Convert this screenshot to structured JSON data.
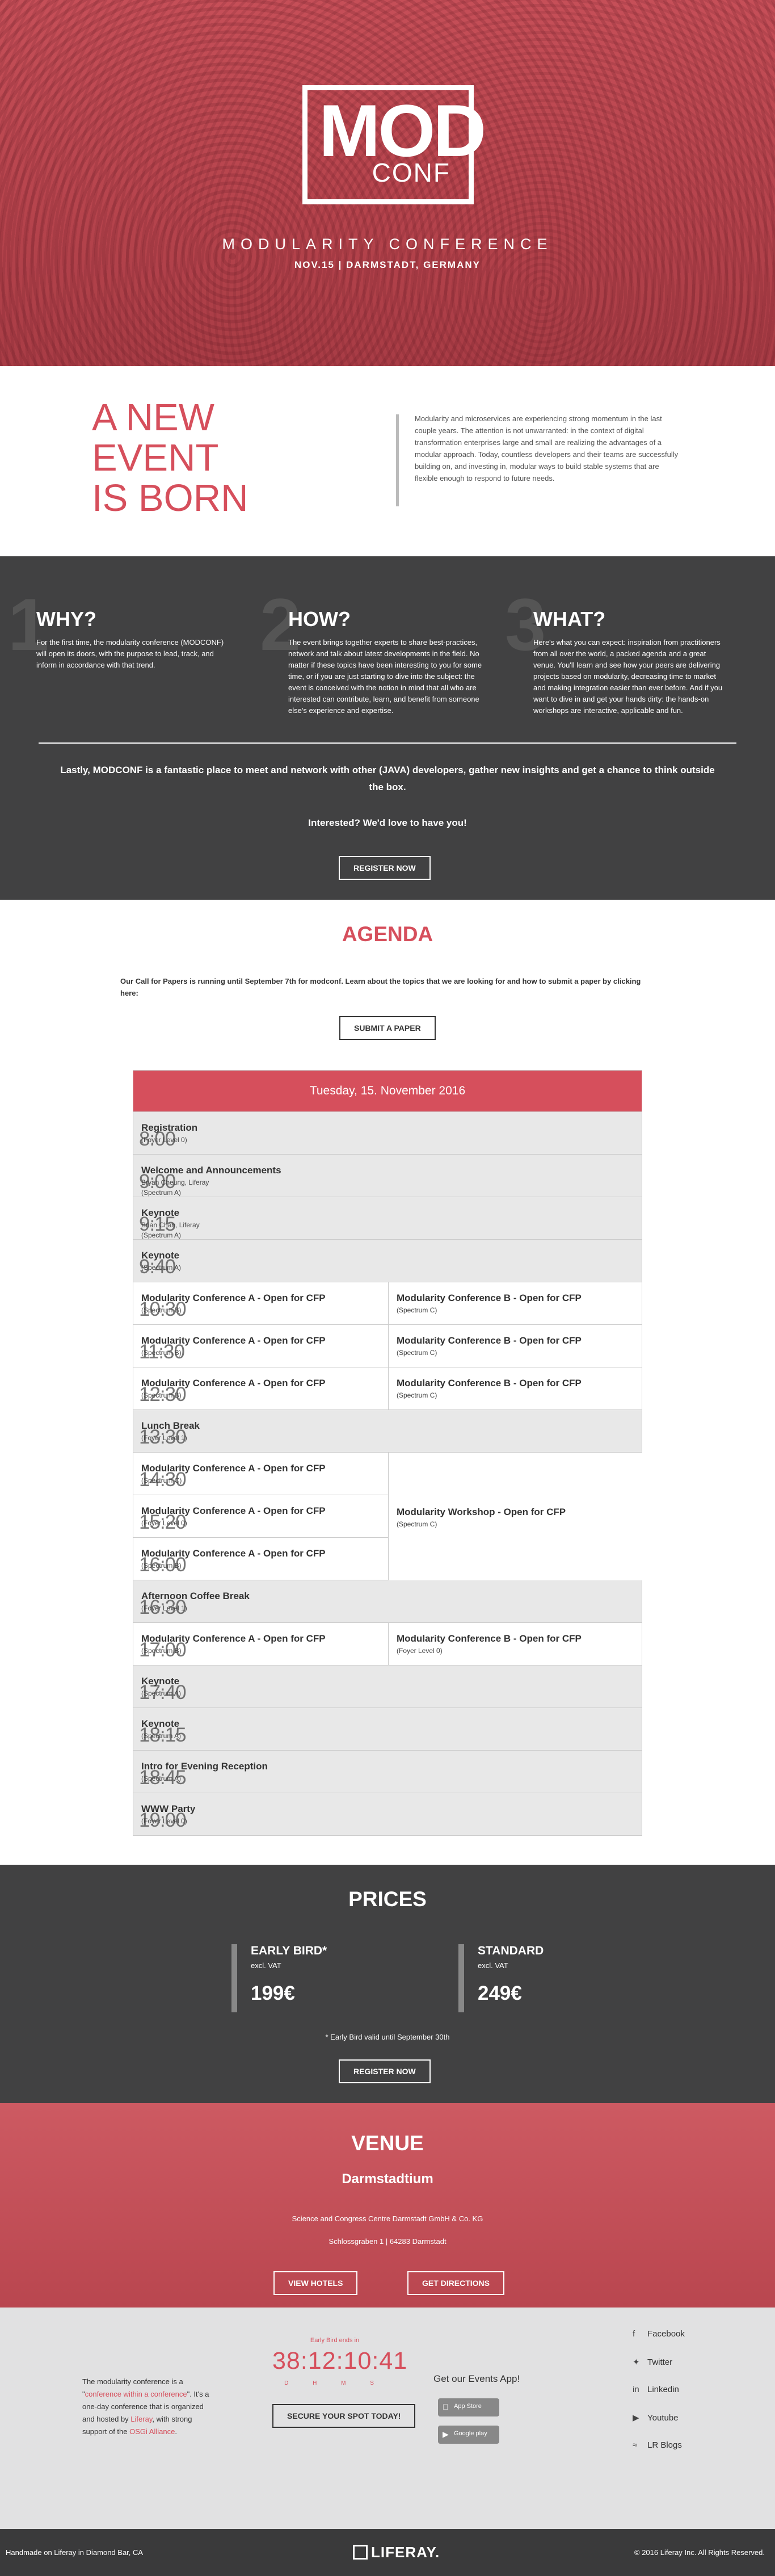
{
  "hero": {
    "logo_top": "MOD",
    "logo_bottom": "CONF",
    "title": "MODULARITY CONFERENCE",
    "subtitle": "NOV.15 | DARMSTADT, GERMANY"
  },
  "intro": {
    "heading": [
      "A NEW",
      "EVENT",
      "IS BORN"
    ],
    "text": "Modularity and microservices are experiencing strong momentum in the last couple years. The attention is not unwarranted: in the context of digital transformation enterprises large and small are realizing the advantages of a modular approach. Today, countless developers and their teams are successfully building on, and investing in, modular ways to build stable systems that are flexible enough to respond to future needs."
  },
  "about": {
    "columns": [
      {
        "num": "1",
        "title": "WHY?",
        "text": "For the first time, the modularity conference (MODCONF) will open its doors, with the purpose to lead, track, and inform in accordance with that trend."
      },
      {
        "num": "2",
        "title": "HOW?",
        "text": "The event brings together experts to share best-practices, network and talk about latest developments in the field. No matter if these topics have been interesting to you for some time, or if you are just starting to dive into the subject: the event is conceived with the notion in mind that all who are interested can contribute, learn, and benefit from someone else's experience and expertise."
      },
      {
        "num": "3",
        "title": "WHAT?",
        "text": "Here's what you can expect: inspiration from practitioners from all over the world, a packed agenda and a great venue. You'll learn and see how your peers are delivering projects based on modularity, decreasing time to market and making integration easier than ever before. And if you want to dive in and get your hands dirty: the hands-on workshops are interactive, applicable and fun."
      }
    ],
    "lastly": "Lastly, MODCONF is a fantastic place to meet and network with other (JAVA) developers, gather new insights and get a chance to think outside the box.",
    "interested": "Interested? We'd love to have you!",
    "register": "REGISTER NOW"
  },
  "agenda": {
    "title": "AGENDA",
    "cfp": "Our Call for Papers is running until September 7th for modconf. Learn about the topics that we are looking for and how to submit a paper by clicking here:",
    "submit": "SUBMIT A PAPER",
    "date": "Tuesday, 15. November 2016",
    "rows": [
      {
        "time": "8:00",
        "a": {
          "t": "Registration",
          "s": "(Foyer Level 0)"
        }
      },
      {
        "time": "9:00",
        "a": {
          "t": "Welcome and Announcements",
          "s": "Bryan Cheung, Liferay",
          "s2": "(Spectrum A)"
        }
      },
      {
        "time": "9:15",
        "a": {
          "t": "Keynote",
          "s": "Brian Chan, Liferay",
          "s2": "(Spectrum A)"
        }
      },
      {
        "time": "9:40",
        "a": {
          "t": "Keynote",
          "s": "(Spectrum A)"
        }
      },
      {
        "time": "10:30",
        "a": {
          "t": "Modularity Conference A - Open for CFP",
          "s": "(Spectrum B)"
        },
        "b": {
          "t": "Modularity Conference B - Open for CFP",
          "s": "(Spectrum C)"
        }
      },
      {
        "time": "11:30",
        "a": {
          "t": "Modularity Conference A - Open for CFP",
          "s": "(Spectrum B)"
        },
        "b": {
          "t": "Modularity Conference B - Open for CFP",
          "s": "(Spectrum C)"
        }
      },
      {
        "time": "12:30",
        "a": {
          "t": "Modularity Conference A - Open for CFP",
          "s": "(Spectrum B)"
        },
        "b": {
          "t": "Modularity Conference B - Open for CFP",
          "s": "(Spectrum C)"
        }
      },
      {
        "time": "13:30",
        "a": {
          "t": "Lunch Break",
          "s": "(Foyer Level 1)"
        }
      },
      {
        "time": "14:30",
        "a": {
          "t": "Modularity Conference A - Open for CFP",
          "s": "(Spectrum C)"
        }
      },
      {
        "time": "15:20",
        "a": {
          "t": "Modularity Conference A - Open for CFP",
          "s": "(Foyer Level 0)"
        }
      },
      {
        "time": "16:00",
        "a": {
          "t": "Modularity Conference A - Open for CFP",
          "s": "(Spectrum B)"
        }
      },
      {
        "time": "16:30",
        "a": {
          "t": "Afternoon Coffee Break",
          "s": "(Foyer Level 1)"
        }
      },
      {
        "time": "17:00",
        "a": {
          "t": "Modularity Conference A - Open for CFP",
          "s": "(Spectrum B)"
        },
        "b": {
          "t": "Modularity Conference B - Open for CFP",
          "s": "(Foyer Level 0)"
        }
      },
      {
        "time": "17:40",
        "a": {
          "t": "Keynote",
          "s": "(Spectrum A)"
        }
      },
      {
        "time": "18:15",
        "a": {
          "t": "Keynote",
          "s": "(Spectrum A)"
        }
      },
      {
        "time": "18:45",
        "a": {
          "t": "Intro for Evening Reception",
          "s": "(Spectrum A)"
        }
      },
      {
        "time": "19:00",
        "a": {
          "t": "WWW Party",
          "s": "(Foyer Level 0)"
        }
      }
    ],
    "workshop": {
      "t": "Modularity Workshop - Open for CFP",
      "s": "(Spectrum C)"
    }
  },
  "prices": {
    "title": "PRICES",
    "early": {
      "name": "EARLY BIRD*",
      "vat": "excl. VAT",
      "price": "199€"
    },
    "standard": {
      "name": "STANDARD",
      "vat": "excl. VAT",
      "price": "249€"
    },
    "note": "* Early Bird valid until September 30th",
    "register": "REGISTER NOW"
  },
  "venue": {
    "title": "VENUE",
    "place": "Darmstadtium",
    "addr1": "Science and Congress Centre Darmstadt GmbH & Co. KG",
    "addr2": "Schlossgraben 1 | 64283 Darmstadt",
    "hotels": "VIEW HOTELS",
    "directions": "GET DIRECTIONS"
  },
  "footer": {
    "about_1": "The modularity conference is a \"",
    "about_link1": "conference within a conference",
    "about_2": "\". It's a one-day conference that is organized and hosted by ",
    "about_link2": "Liferay",
    "about_3": ", with strong support of the ",
    "about_link3": "OSGi Alliance",
    "about_4": ".",
    "countdown_label": "Early Bird ends in",
    "countdown": "38:12:10:41",
    "units": "D H M S",
    "secure": "SECURE YOUR SPOT TODAY!",
    "app": "Get our Events App!",
    "appstore": "App Store",
    "googleplay": "Google play",
    "social": [
      "Facebook",
      "Twitter",
      "Linkedin",
      "Youtube",
      "LR Blogs"
    ]
  },
  "bottom": {
    "left": "Handmade on Liferay in Diamond Bar, CA",
    "brand": "LIFERAY.",
    "right": "© 2016 Liferay Inc. All Rights Reserved."
  }
}
